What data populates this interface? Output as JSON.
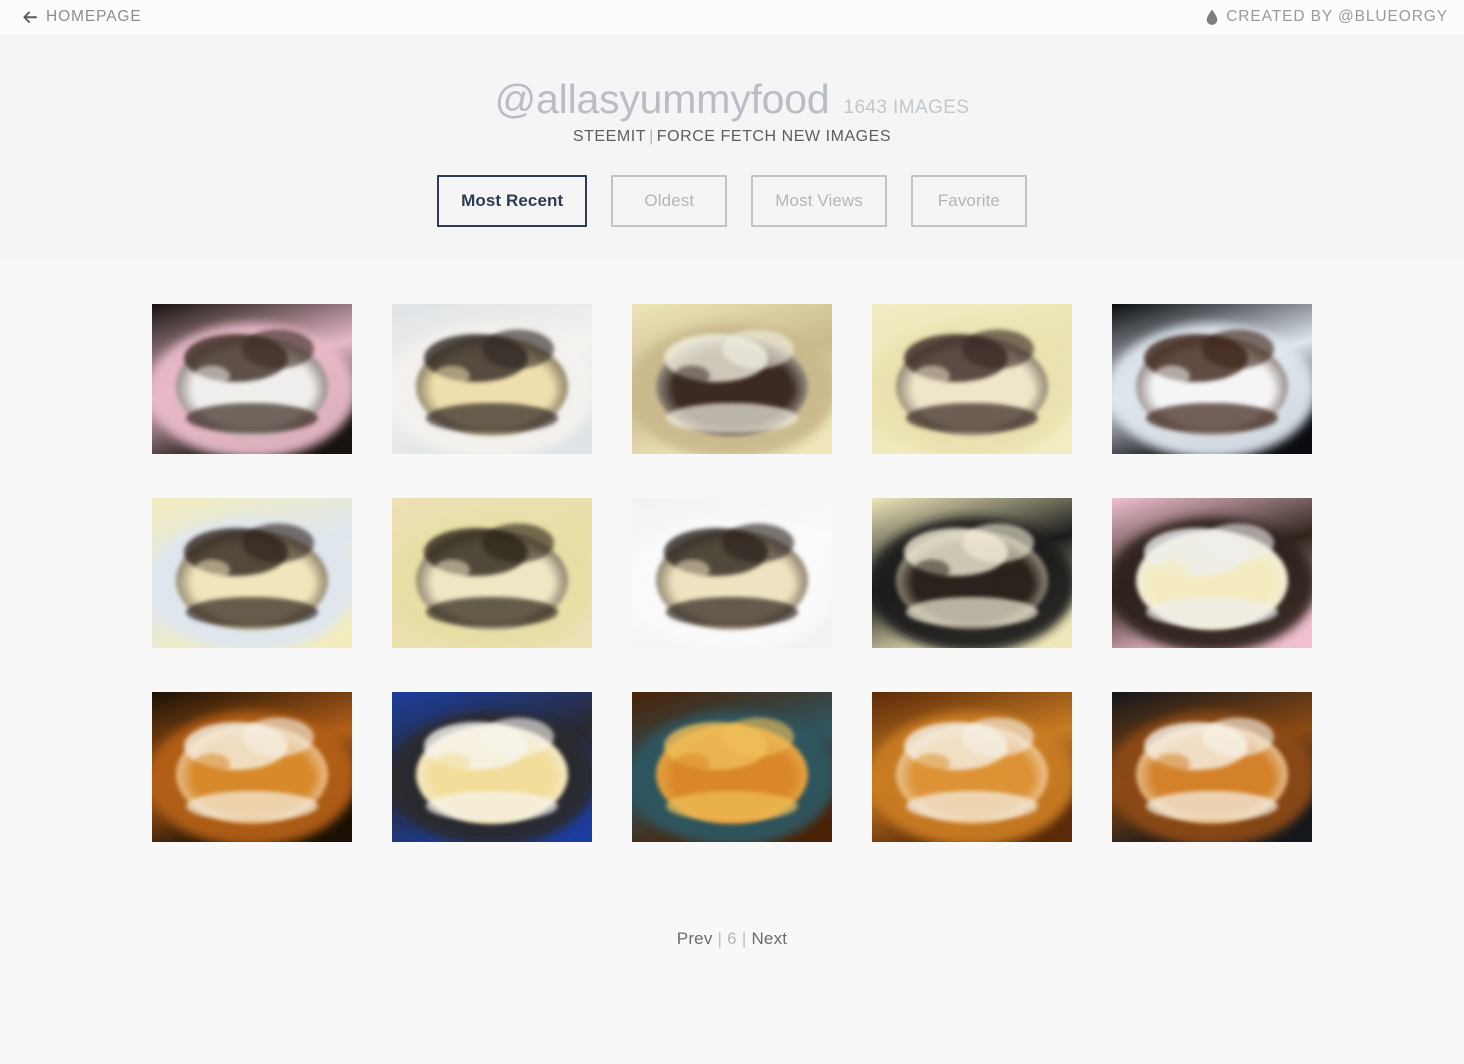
{
  "topbar": {
    "back_icon": "arrow-left-icon",
    "homepage_label": "HOMEPAGE",
    "drop_icon": "water-drop-icon",
    "credit_label": "CREATED BY @BLUEORGY"
  },
  "hero": {
    "handle": "@allasyummyfood",
    "image_count": "1643 IMAGES",
    "link_steemit": "STEEMIT",
    "link_separator": "|",
    "link_force_fetch": "FORCE FETCH NEW IMAGES"
  },
  "filters": {
    "buttons": [
      {
        "label": "Most Recent",
        "active": true
      },
      {
        "label": "Oldest",
        "active": false
      },
      {
        "label": "Most Views",
        "active": false
      },
      {
        "label": "Favorite",
        "active": false
      }
    ]
  },
  "gallery": {
    "columns": 5,
    "thumb_width": 200,
    "thumb_height": 150,
    "items": [
      {
        "id": "thumb-1",
        "alt": "Oreo cheesecake slice with chocolate drizzle on white plate with flowers",
        "palette": [
          "#17130f",
          "#f0eeec",
          "#3a2a22",
          "#e8b9c8"
        ]
      },
      {
        "id": "thumb-2",
        "alt": "Close-up cheesecake slice with cookie crumble topping on white plate",
        "palette": [
          "#dfe3e6",
          "#efdfae",
          "#2e2521",
          "#f4f2ef"
        ]
      },
      {
        "id": "thumb-3",
        "alt": "Whole oreo cheesecake on yellow plate with one slice removed",
        "palette": [
          "#eee6b8",
          "#3a2b22",
          "#f3f0e2",
          "#c9b98c"
        ]
      },
      {
        "id": "thumb-4",
        "alt": "Cheesecake on pale yellow plate sliced open showing layers",
        "palette": [
          "#f2edc3",
          "#efe5c8",
          "#342720",
          "#e9e2b0"
        ]
      },
      {
        "id": "thumb-5",
        "alt": "Cheesecake slice on white plate against dark background",
        "palette": [
          "#0a0c10",
          "#f5f5f7",
          "#3a2418",
          "#dfe6ee"
        ]
      },
      {
        "id": "thumb-6",
        "alt": "Cut cheesecake showing cream filling and dark chocolate base on yellow plate",
        "palette": [
          "#f3edbe",
          "#f0e5bb",
          "#2e241d",
          "#dfe6ef"
        ]
      },
      {
        "id": "thumb-7",
        "alt": "Side view of layered cheesecake with dark cookie crust on yellow plate",
        "palette": [
          "#ece0b5",
          "#efe6c4",
          "#2a2019",
          "#e7dfa6"
        ]
      },
      {
        "id": "thumb-8",
        "alt": "Triangular cheesecake slice with chocolate chunks on white plate",
        "palette": [
          "#f2f2f2",
          "#efe2c0",
          "#2c221c",
          "#fbfbfb"
        ]
      },
      {
        "id": "thumb-9",
        "alt": "Cheesecake with white chocolate drizzle on yellow plate on dark surface",
        "palette": [
          "#eee7ba",
          "#2a211a",
          "#f5efd8",
          "#1b1b1b"
        ]
      },
      {
        "id": "thumb-10",
        "alt": "Cheesecake slice on white plate with pink and yellow flowers behind",
        "palette": [
          "#f0c0cf",
          "#f4ecc0",
          "#efefef",
          "#2e241c"
        ]
      },
      {
        "id": "thumb-11",
        "alt": "Cinnamon rolls with white icing drizzle close-up",
        "palette": [
          "#1b1005",
          "#d8892c",
          "#f6f1e4",
          "#b35f18"
        ]
      },
      {
        "id": "thumb-12",
        "alt": "Risen bread dough in glass bowl wrapped with blue checkered towel",
        "palette": [
          "#1c3d9e",
          "#f2dd9a",
          "#f7f5ef",
          "#2a2a2e"
        ]
      },
      {
        "id": "thumb-13",
        "alt": "Baked cinnamon rolls in glass baking dish",
        "palette": [
          "#4a2206",
          "#d9872a",
          "#f0c05a",
          "#2e5661"
        ]
      },
      {
        "id": "thumb-14",
        "alt": "Cinnamon rolls with icing in baking pan overhead view",
        "palette": [
          "#5a2a09",
          "#dd9336",
          "#f6f2e8",
          "#c97c23"
        ]
      },
      {
        "id": "thumb-15",
        "alt": "Cinnamon rolls with icing in glass pan on dark surface",
        "palette": [
          "#14171c",
          "#d3822a",
          "#f8f4ea",
          "#8c4a12"
        ]
      }
    ]
  },
  "pagination": {
    "prev_label": "Prev",
    "separator": "|",
    "current_page": "6",
    "next_label": "Next"
  }
}
